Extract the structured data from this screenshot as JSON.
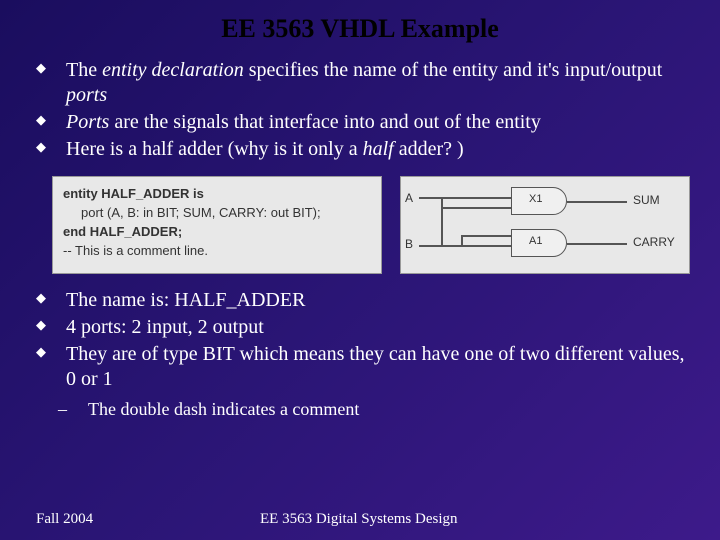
{
  "title": "EE 3563 VHDL Example",
  "bullets_top": [
    {
      "pre": "The ",
      "em1": "entity declaration",
      "mid": " specifies the name of the entity and it's input/output ",
      "em2": "ports",
      "post": ""
    },
    {
      "pre": "",
      "em1": "Ports",
      "mid": " are the signals that interface into and out of the entity",
      "em2": "",
      "post": ""
    },
    {
      "pre": "Here is a half adder  (why is it only a ",
      "em1": "half",
      "mid": " adder? )",
      "em2": "",
      "post": ""
    }
  ],
  "code": {
    "l1": "entity HALF_ADDER is",
    "l2": "port (A, B: in BIT; SUM, CARRY: out BIT);",
    "l3": "end HALF_ADDER;",
    "l4": "-- This is a comment line."
  },
  "diagram": {
    "in1": "A",
    "in2": "B",
    "g1": "X1",
    "g2": "A1",
    "out1": "SUM",
    "out2": "CARRY"
  },
  "bullets_bottom": [
    "The name is:  HALF_ADDER",
    "4 ports: 2 input, 2 output",
    "They are of type BIT which means they can have one of two different values, 0 or 1"
  ],
  "sub_bullet": "The double dash indicates a comment",
  "footer": {
    "left": "Fall 2004",
    "center": "EE 3563 Digital Systems Design"
  }
}
